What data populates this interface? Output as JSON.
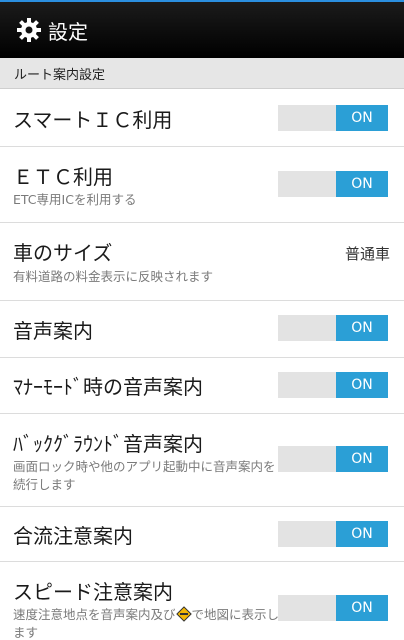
{
  "header": {
    "title": "設定",
    "icon": "gear-icon"
  },
  "section": {
    "label": "ルート案内設定"
  },
  "rows": {
    "smart_ic": {
      "title": "スマートＩＣ利用",
      "toggle": "ON"
    },
    "etc": {
      "title": "ＥＴＣ利用",
      "desc": "ETC専用ICを利用する",
      "toggle": "ON"
    },
    "car_size": {
      "title": "車のサイズ",
      "desc": "有料道路の料金表示に反映されます",
      "value": "普通車"
    },
    "voice": {
      "title": "音声案内",
      "toggle": "ON"
    },
    "manner": {
      "title": "ﾏﾅｰﾓｰﾄﾞ時の音声案内",
      "toggle": "ON"
    },
    "background": {
      "title": "ﾊﾞｯｸｸﾞﾗｳﾝﾄﾞ音声案内",
      "desc": "画面ロック時や他のアプリ起動中に音声案内を続行します",
      "toggle": "ON"
    },
    "merge": {
      "title": "合流注意案内",
      "toggle": "ON"
    },
    "speed": {
      "title": "スピード注意案内",
      "desc_before": "速度注意地点を音声案内及び",
      "desc_after": "で地図に表示します",
      "toggle": "ON"
    }
  },
  "colors": {
    "accent": "#2b9fd6",
    "header_bg": "#000000",
    "section_bg": "#e6e6e6"
  }
}
